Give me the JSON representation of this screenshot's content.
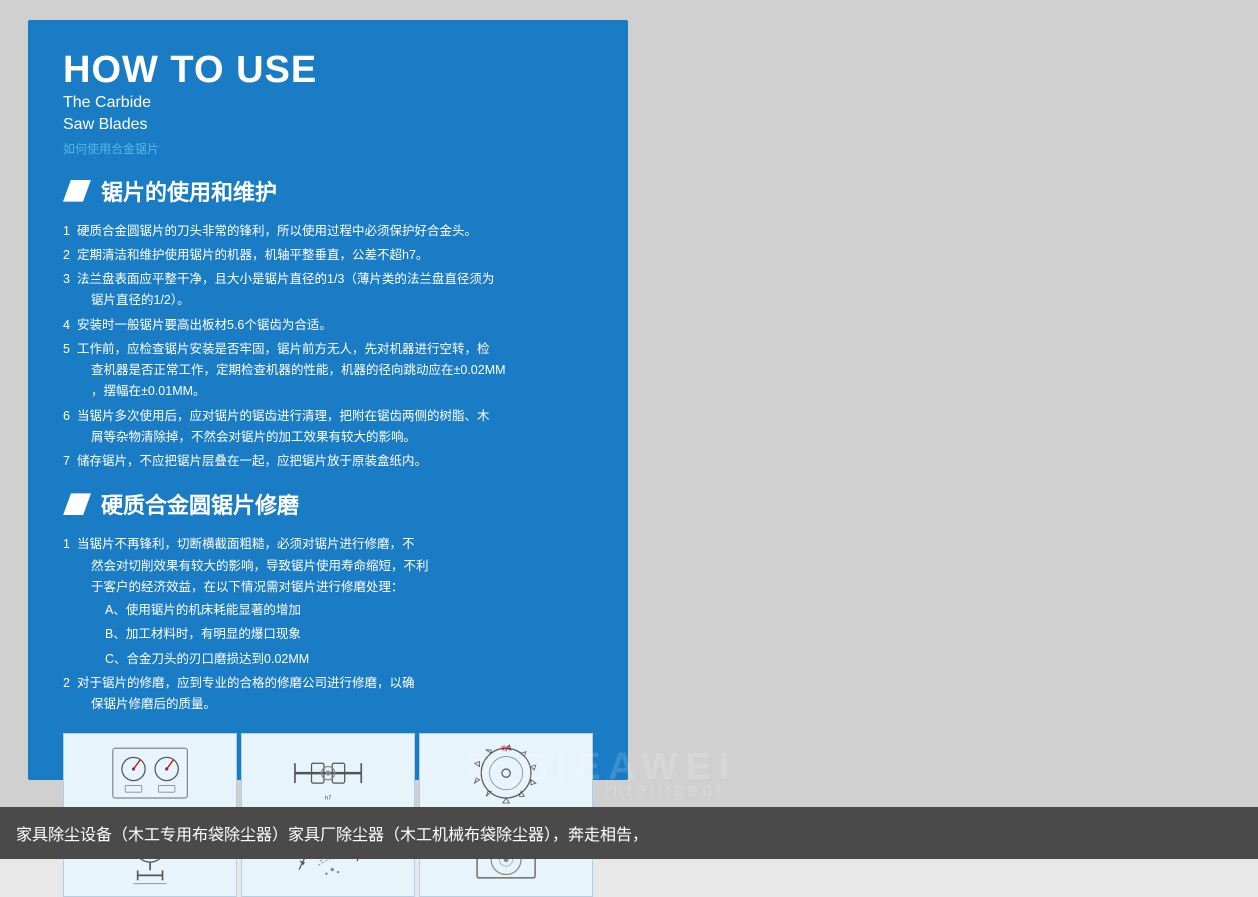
{
  "header": {
    "title": "HOW TO USE",
    "subtitle1": "The Carbide",
    "subtitle2": "Saw Blades",
    "chinese_subtitle": "如何使用合金锯片"
  },
  "section1": {
    "title": "锯片的使用和维护",
    "items": [
      "硬质合金圆锯片的刀头非常的锋利，所以使用过程中必须保护好合金头。",
      "定期清洁和维护使用锯片的机器，机轴平整垂直，公差不超h7。",
      "法兰盘表面应平整干净，且大小是锯片直径的1/3（薄片类的法兰盘直径须为锯片直径的1/2）。",
      "安装时一般锯片要高出板材5.6个锯齿为合适。",
      "工作前，应检查锯片安装是否牢固，锯片前方无人，先对机器进行空转，检查机器是否正常工作，定期检查机器的性能，机器的径向跳动应在±0.02MM，摆幅在±0.01MM。",
      "当锯片多次使用后，应对锯片的锯齿进行清理，把附在锯齿两侧的树脂、木屑等杂物清除掉，不然会对锯片的加工效果有较大的影响。",
      "储存锯片，不应把锯片层叠在一起，应把锯片放于原装盒纸内。"
    ]
  },
  "section2": {
    "title": "硬质合金圆锯片修磨",
    "item1_main": "当锯片不再锋利，切断横截面粗糙，必须对锯片进行修磨，不然会对切削效果有较大的影响，导致锯片使用寿命缩短，不利于客户的经济效益，在以下情况需对锯片进行修磨处理：",
    "item1_subs": [
      "A、使用锯片的机床耗能显著的增加",
      "B、加工材料时，有明显的爆口现象",
      "C、合金刀头的刃口磨损达到0.02MM"
    ],
    "item2": "对于锯片的修磨，应到专业的合格的修磨公司进行修磨，以确保锯片修磨后的质量。"
  },
  "bottom_bar": {
    "text": "家具除尘设备（木工专用布袋除尘器）家具厂除尘器（木工机械布袋除尘器），奔走相告，"
  },
  "watermark": {
    "main": "© BIEAWEI",
    "sub": "intelligent"
  }
}
